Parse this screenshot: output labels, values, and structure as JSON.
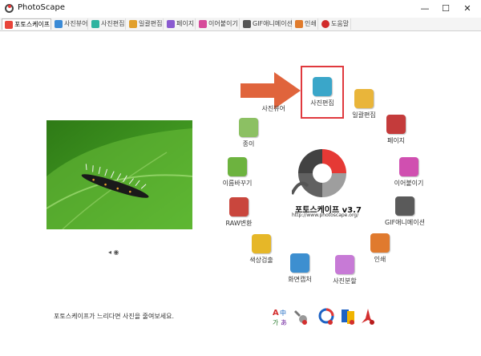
{
  "window": {
    "title": "PhotoScape",
    "minimize_glyph": "—",
    "maximize_glyph": "☐",
    "close_glyph": "✕"
  },
  "tabs": [
    {
      "label": "포토스케이프",
      "icon": "photoscape-icon",
      "color": "#e8443a"
    },
    {
      "label": "사진뷰어",
      "icon": "viewer-icon",
      "color": "#3a8ad6"
    },
    {
      "label": "사진편집",
      "icon": "editor-icon",
      "color": "#2fb3a0"
    },
    {
      "label": "일괄편집",
      "icon": "batch-icon",
      "color": "#e2a02c"
    },
    {
      "label": "페이지",
      "icon": "page-icon",
      "color": "#8a5ad0"
    },
    {
      "label": "이어붙이기",
      "icon": "combine-icon",
      "color": "#d64a9a"
    },
    {
      "label": "GIF애니메이션",
      "icon": "gif-icon",
      "color": "#555555"
    },
    {
      "label": "인쇄",
      "icon": "print-icon",
      "color": "#e07b2c"
    },
    {
      "label": "도움말",
      "icon": "help-icon",
      "color": "#d12a2a"
    }
  ],
  "preview": {
    "controls_text": "◂ ◉",
    "hint": "포토스케이프가 느리다면 사진을 줄여보세요."
  },
  "logo": {
    "name": "포토스케이프 v3.7",
    "url": "http://www.photoscape.org/"
  },
  "menu": [
    {
      "label": "사진편집",
      "icon": "photo-editor-icon",
      "color": "#3aa6c9"
    },
    {
      "label": "일괄편집",
      "icon": "batch-editor-icon",
      "color": "#e9b53a"
    },
    {
      "label": "페이지",
      "icon": "page-icon",
      "color": "#c43b3b"
    },
    {
      "label": "이어붙이기",
      "icon": "combine-icon",
      "color": "#d04fb0"
    },
    {
      "label": "GIF애니메이션",
      "icon": "gif-animation-icon",
      "color": "#5a5a5a"
    },
    {
      "label": "인쇄",
      "icon": "print-icon",
      "color": "#e07a2e"
    },
    {
      "label": "사진분할",
      "icon": "splitter-icon",
      "color": "#c77ad6"
    },
    {
      "label": "화면캡처",
      "icon": "screen-capture-icon",
      "color": "#3d8fd0"
    },
    {
      "label": "색상검출",
      "icon": "color-picker-icon",
      "color": "#e6b728"
    },
    {
      "label": "RAW변환",
      "icon": "raw-converter-icon",
      "color": "#c9463d"
    },
    {
      "label": "이름바꾸기",
      "icon": "rename-icon",
      "color": "#6db33f"
    },
    {
      "label": "종이",
      "icon": "paper-print-icon",
      "color": "#8cc063"
    },
    {
      "label": "사진뷰어",
      "icon": "photo-viewer-icon",
      "color": "#4a90c8"
    }
  ],
  "bottom_tools": [
    {
      "icon": "language-icon"
    },
    {
      "icon": "settings-wrench-icon"
    },
    {
      "icon": "tool-icon-3"
    },
    {
      "icon": "tool-icon-4"
    },
    {
      "icon": "tool-icon-5"
    }
  ]
}
